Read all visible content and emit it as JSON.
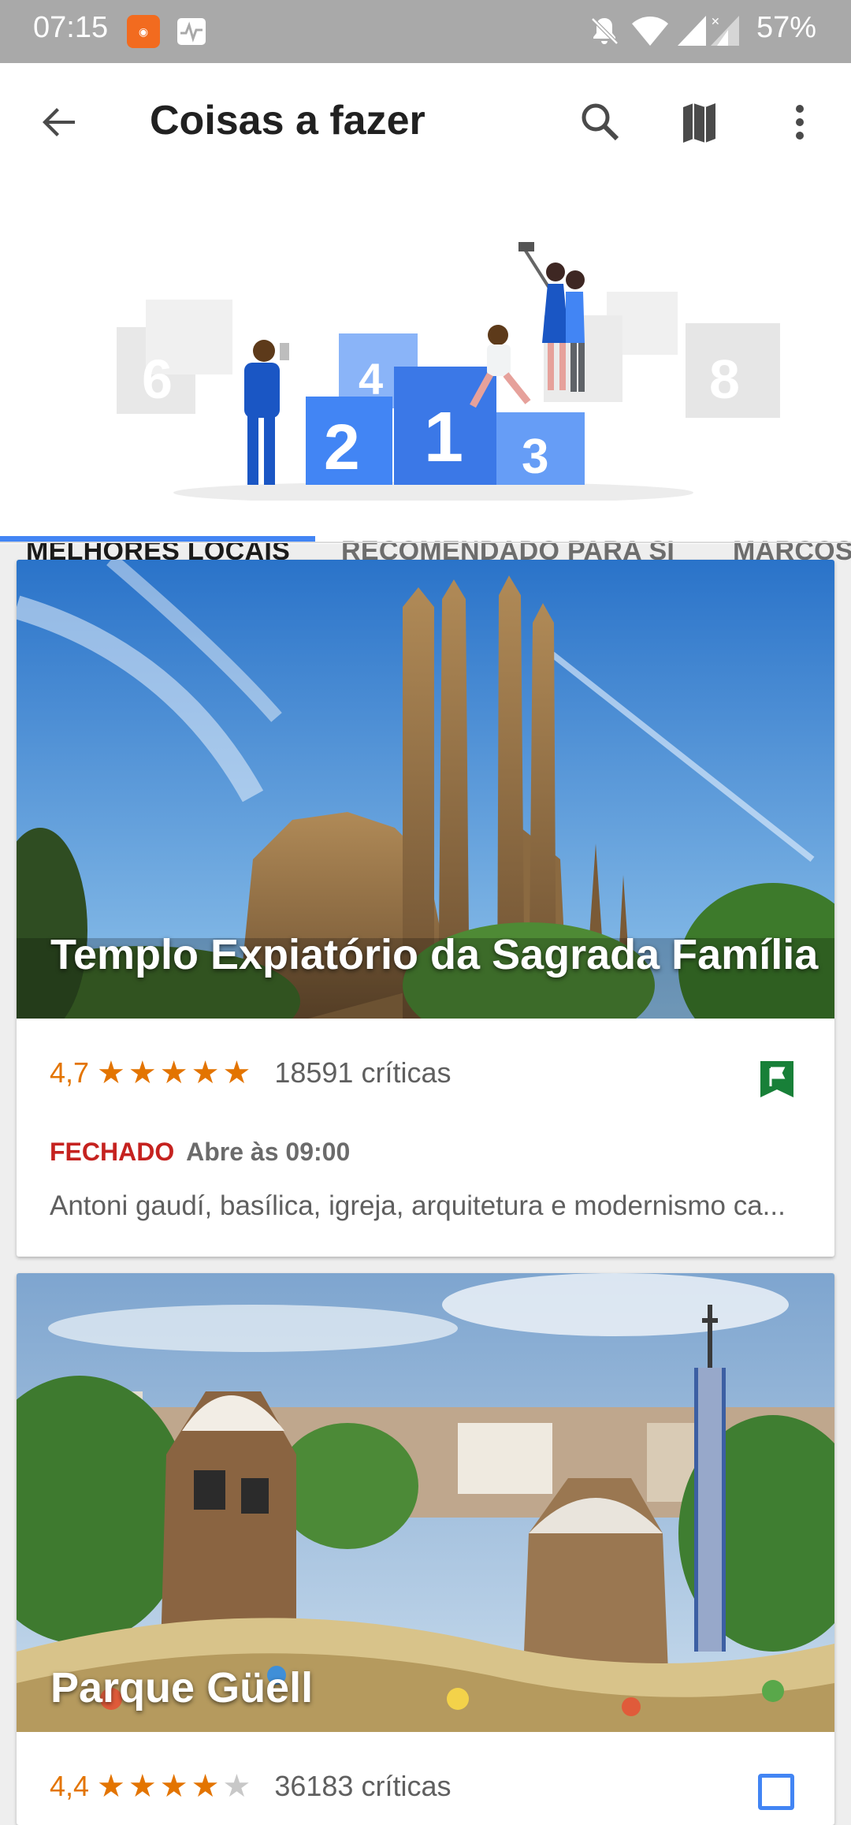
{
  "status_bar": {
    "time": "07:15",
    "app_badge_icon": "mi-app-icon",
    "battery_percent": "57%"
  },
  "header": {
    "title": "Coisas a fazer",
    "illustration_numbers": [
      "6",
      "4",
      "2",
      "1",
      "3",
      "8"
    ]
  },
  "tabs": [
    {
      "label": "MELHORES LOCAIS",
      "active": true
    },
    {
      "label": "RECOMENDADO PARA SI",
      "active": false
    },
    {
      "label": "MARCOS",
      "active": false
    }
  ],
  "places": [
    {
      "name": "Templo Expiatório da Sagrada Família",
      "rating": "4,7",
      "stars_filled": 5,
      "reviews": "18591 críticas",
      "status_closed": "FECHADO",
      "opens": "Abre às 09:00",
      "description": "Antoni gaudí, basílica, igreja, arquitetura e modernismo ca...",
      "saved": true
    },
    {
      "name": "Parque Güell",
      "rating": "4,4",
      "stars_filled": 4.4,
      "reviews": "36183 críticas",
      "saved": false
    }
  ],
  "colors": {
    "accent": "#4285f4",
    "rating": "#e37400",
    "closed": "#c5221f",
    "saved_flag": "#188038"
  }
}
